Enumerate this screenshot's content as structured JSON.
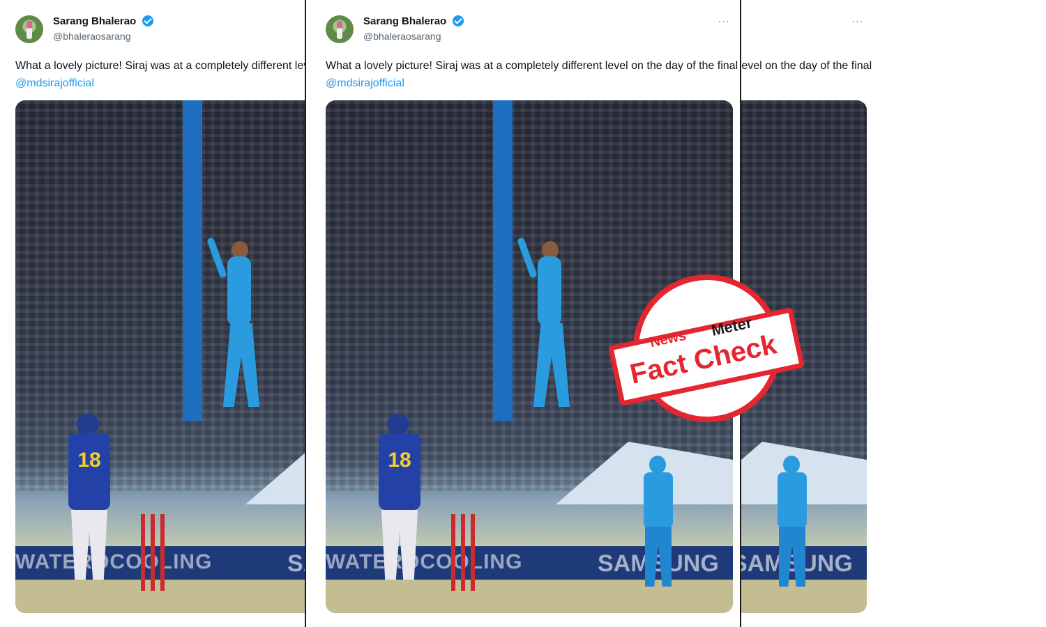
{
  "tweet": {
    "author_name": "Sarang Bhalerao",
    "author_handle": "@bhaleraosarang",
    "more_label": "···",
    "text": "What a lovely picture! Siraj was at a completely different level on the day of the final",
    "mention": "@mdsirajofficial",
    "photo_alt": "Mohammed Siraj celebrating mid-air during the final",
    "ad_left": "WATEROCOOLING",
    "ad_right": "SAMSUNG",
    "batsman_number": "18"
  },
  "stamp": {
    "brand_part_1": "News",
    "brand_part_2": "Meter",
    "title": "Fact Check"
  },
  "colors": {
    "verified": "#1d9bf0",
    "link": "#1d9bf0",
    "stamp_red": "#e3262f"
  },
  "icons": [
    "verified-badge-icon",
    "more-icon"
  ]
}
